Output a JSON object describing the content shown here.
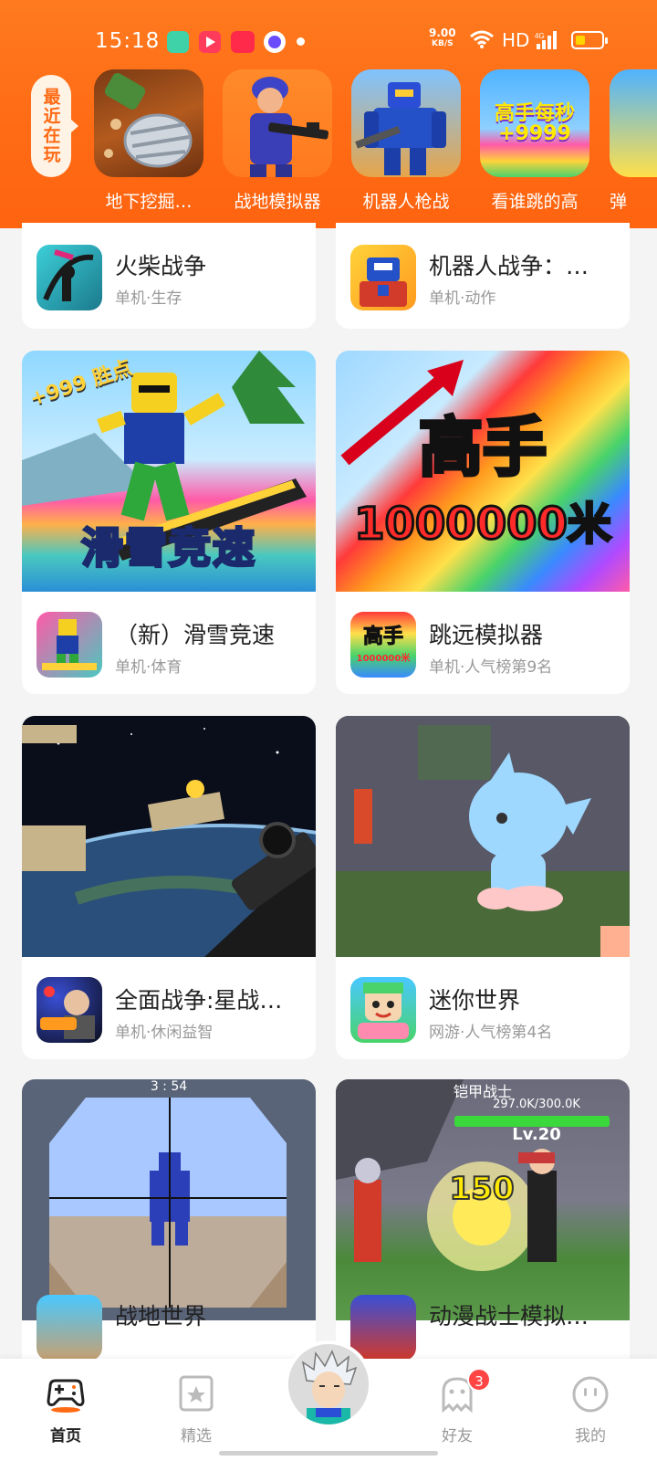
{
  "status_bar": {
    "time": "15:18",
    "net_speed_value": "9.00",
    "net_speed_unit": "KB/S",
    "network_label": "HD",
    "signal_label": "4G"
  },
  "recent": {
    "tab_label": "最近在玩",
    "games": [
      {
        "label": "地下挖掘…"
      },
      {
        "label": "战地模拟器"
      },
      {
        "label": "机器人枪战"
      },
      {
        "label": "看谁跳的高"
      },
      {
        "label": "弹"
      }
    ],
    "promo_text": "高手每秒",
    "promo_number": "+9999"
  },
  "cards": [
    {
      "name": "火柴战争",
      "meta": "单机·生存"
    },
    {
      "name": "机器人战争：…",
      "meta": "单机·动作"
    },
    {
      "name": "（新）滑雪竞速",
      "meta": "单机·体育",
      "banner_text": "滑雪竞速",
      "banner_badge": "+999 胜点"
    },
    {
      "name": "跳远模拟器",
      "meta": "单机·人气榜第9名",
      "banner_text": "高手",
      "banner_number": "1000000米"
    },
    {
      "name": "全面战争:星战…",
      "meta": "单机·休闲益智"
    },
    {
      "name": "迷你世界",
      "meta": "网游·人气榜第4名"
    },
    {
      "name": "战地世界",
      "meta": "",
      "banner_timer": "3 : 54"
    },
    {
      "name": "动漫战士模拟…",
      "meta": "",
      "banner_title": "铠甲战士",
      "banner_hp": "297.0K/300.0K",
      "banner_level": "Lv.20",
      "banner_damage": "150"
    }
  ],
  "nav": {
    "home": "首页",
    "featured": "精选",
    "friends": "好友",
    "friends_badge": "3",
    "mine": "我的"
  },
  "colors": {
    "brand_orange": "#ff6a14",
    "badge_red": "#ff4444"
  }
}
